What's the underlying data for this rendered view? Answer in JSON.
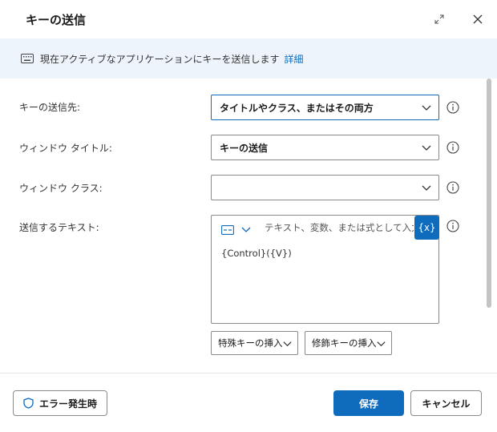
{
  "dialog": {
    "title": "キーの送信"
  },
  "banner": {
    "icon": "keyboard-icon",
    "text": "現在アクティブなアプリケーションにキーを送信します",
    "link": "詳細"
  },
  "form": {
    "target": {
      "label": "キーの送信先:",
      "value": "タイトルやクラス、またはその両方"
    },
    "window_title": {
      "label": "ウィンドウ タイトル:",
      "value": "キーの送信"
    },
    "window_class": {
      "label": "ウィンドウ クラス:",
      "value": ""
    },
    "text_to_send": {
      "label": "送信するテキスト:",
      "placeholder": "テキスト、変数、または式として入力します",
      "value": "{Control}({V})",
      "variable_button": "{x}"
    },
    "special_key_dropdown": "特殊キーの挿入",
    "modifier_key_dropdown": "修飾キーの挿入"
  },
  "footer": {
    "on_error": "エラー発生時",
    "save": "保存",
    "cancel": "キャンセル"
  },
  "colors": {
    "accent": "#0f6cbd",
    "banner_bg": "#eef4fc"
  }
}
